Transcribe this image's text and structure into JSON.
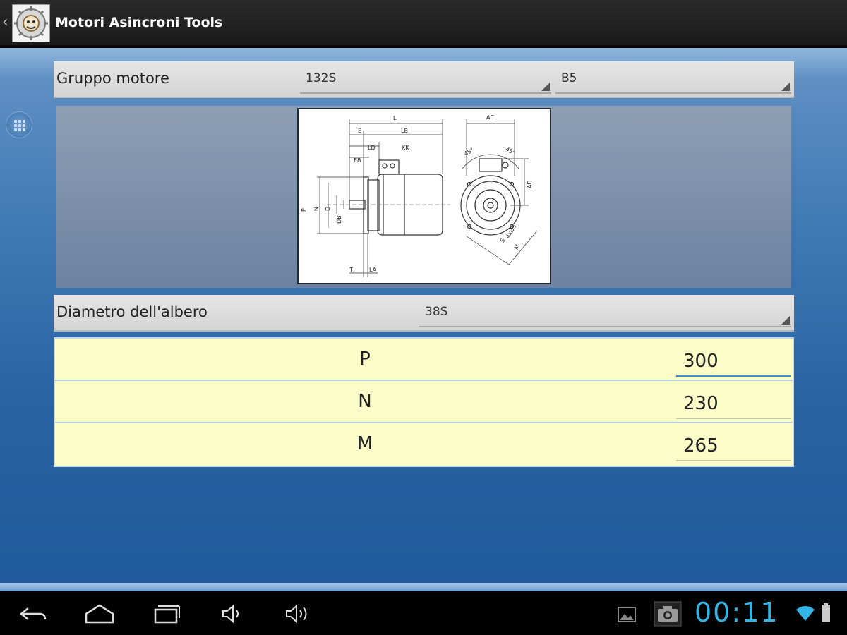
{
  "app": {
    "title": "Motori Asincroni Tools"
  },
  "gruppo": {
    "label": "Gruppo motore",
    "size_value": "132S",
    "mount_value": "B5"
  },
  "diagram": {
    "labels": [
      "L",
      "AC",
      "E",
      "LB",
      "LD",
      "KK",
      "EB",
      "AD",
      "P",
      "N",
      "D",
      "DB",
      "T",
      "LA",
      "S",
      "M",
      "45°",
      "4xØS"
    ]
  },
  "albero": {
    "label": "Diametro dell'albero",
    "value": "38S"
  },
  "values": [
    {
      "name": "P",
      "value": "300"
    },
    {
      "name": "N",
      "value": "230"
    },
    {
      "name": "M",
      "value": "265"
    }
  ],
  "status": {
    "clock": "00:11"
  },
  "colors": {
    "accent": "#33b5e5",
    "table_bg": "#fbfdc8"
  }
}
